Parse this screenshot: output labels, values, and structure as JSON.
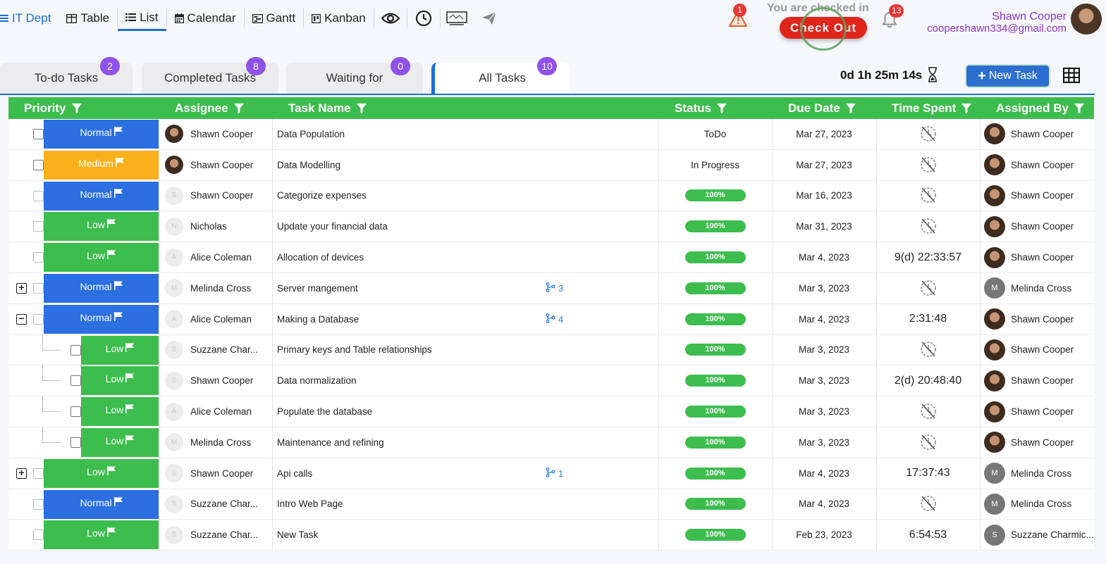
{
  "nav": {
    "dept": "IT Dept",
    "views": [
      {
        "label": "Table",
        "icon": "table-icon"
      },
      {
        "label": "List",
        "icon": "list-icon",
        "active": true
      },
      {
        "label": "Calendar",
        "icon": "calendar-icon"
      },
      {
        "label": "Gantt",
        "icon": "gantt-icon"
      },
      {
        "label": "Kanban",
        "icon": "kanban-icon"
      }
    ]
  },
  "header": {
    "alert_count": "1",
    "checked_in_text": "You are checked in",
    "checkout_label": "Check Out",
    "notification_count": "13",
    "user_name": "Shawn Cooper",
    "user_email": "coopershawn334@gmail.com"
  },
  "tabs": [
    {
      "label": "To-do Tasks",
      "count": "2"
    },
    {
      "label": "Completed Tasks",
      "count": "8"
    },
    {
      "label": "Waiting for",
      "count": "0"
    },
    {
      "label": "All Tasks",
      "count": "10",
      "active": true
    }
  ],
  "toolbar": {
    "timer": "0d 1h 25m 14s",
    "new_task_label": "New Task"
  },
  "columns": [
    "Priority",
    "Assignee",
    "Task Name",
    "Status",
    "Due Date",
    "Time Spent",
    "Assigned By"
  ],
  "colors": {
    "normal": "#2b6fe0",
    "medium": "#f9b11b",
    "low": "#3dbd4e",
    "header": "#3dbd4e",
    "accent": "#1a6fd8"
  },
  "rows": [
    {
      "priority": "Normal",
      "assignee": "Shawn Cooper",
      "av": "photo",
      "task": "Data Population",
      "status": "ToDo",
      "due": "Mar 27, 2023",
      "time": "",
      "by": "Shawn Cooper",
      "by_av": "photo",
      "level": 0
    },
    {
      "priority": "Medium",
      "assignee": "Shawn Cooper",
      "av": "photo",
      "task": "Data Modelling",
      "status": "In Progress",
      "due": "Mar 27, 2023",
      "time": "",
      "by": "Shawn Cooper",
      "by_av": "photo",
      "level": 0
    },
    {
      "priority": "Normal",
      "assignee": "Shawn Cooper",
      "av": "S",
      "task": "Categorize expenses",
      "status": "100%",
      "due": "Mar 16, 2023",
      "time": "",
      "by": "Shawn Cooper",
      "by_av": "photo",
      "level": 0
    },
    {
      "priority": "Low",
      "assignee": "Nicholas",
      "av": "N",
      "task": "Update your financial data",
      "status": "100%",
      "due": "Mar 31, 2023",
      "time": "",
      "by": "Shawn Cooper",
      "by_av": "photo",
      "level": 0
    },
    {
      "priority": "Low",
      "assignee": "Alice Coleman",
      "av": "A",
      "task": "Allocation of devices",
      "status": "100%",
      "due": "Mar 4, 2023",
      "time": "9(d) 22:33:57",
      "by": "Shawn Cooper",
      "by_av": "photo",
      "level": 0
    },
    {
      "priority": "Normal",
      "assignee": "Melinda Cross",
      "av": "M",
      "task": "Server mangement",
      "status": "100%",
      "due": "Mar 3, 2023",
      "time": "",
      "by": "Melinda Cross",
      "by_av": "M",
      "level": 0,
      "expander": "+",
      "subtasks": "3"
    },
    {
      "priority": "Normal",
      "assignee": "Alice Coleman",
      "av": "A",
      "task": "Making a Database",
      "status": "100%",
      "due": "Mar 4, 2023",
      "time": "2:31:48",
      "by": "Shawn Cooper",
      "by_av": "photo",
      "level": 0,
      "expander": "−",
      "subtasks": "4"
    },
    {
      "priority": "Low",
      "assignee": "Suzzane Char...",
      "av": "S",
      "task": "Primary keys and Table relationships",
      "status": "100%",
      "due": "Mar 3, 2023",
      "time": "",
      "by": "Shawn Cooper",
      "by_av": "photo",
      "level": 1
    },
    {
      "priority": "Low",
      "assignee": "Shawn Cooper",
      "av": "S",
      "task": "Data normalization",
      "status": "100%",
      "due": "Mar 3, 2023",
      "time": "2(d) 20:48:40",
      "by": "Shawn Cooper",
      "by_av": "photo",
      "level": 1
    },
    {
      "priority": "Low",
      "assignee": "Alice Coleman",
      "av": "A",
      "task": "Populate the database",
      "status": "100%",
      "due": "Mar 3, 2023",
      "time": "",
      "by": "Shawn Cooper",
      "by_av": "photo",
      "level": 1
    },
    {
      "priority": "Low",
      "assignee": "Melinda Cross",
      "av": "M",
      "task": "Maintenance and refining",
      "status": "100%",
      "due": "Mar 3, 2023",
      "time": "",
      "by": "Shawn Cooper",
      "by_av": "photo",
      "level": 1
    },
    {
      "priority": "Low",
      "assignee": "Shawn Cooper",
      "av": "S",
      "task": "Api calls",
      "status": "100%",
      "due": "Mar 4, 2023",
      "time": "17:37:43",
      "by": "Melinda Cross",
      "by_av": "M",
      "level": 0,
      "expander": "+",
      "subtasks": "1"
    },
    {
      "priority": "Normal",
      "assignee": "Suzzane Char...",
      "av": "S",
      "task": "Intro Web Page",
      "status": "100%",
      "due": "Mar 4, 2023",
      "time": "",
      "by": "Melinda Cross",
      "by_av": "M",
      "level": 0
    },
    {
      "priority": "Low",
      "assignee": "Suzzane Char...",
      "av": "S",
      "task": "New Task",
      "status": "100%",
      "due": "Feb 23, 2023",
      "time": "6:54:53",
      "by": "Suzzane Charmic...",
      "by_av": "S",
      "level": 0
    }
  ]
}
